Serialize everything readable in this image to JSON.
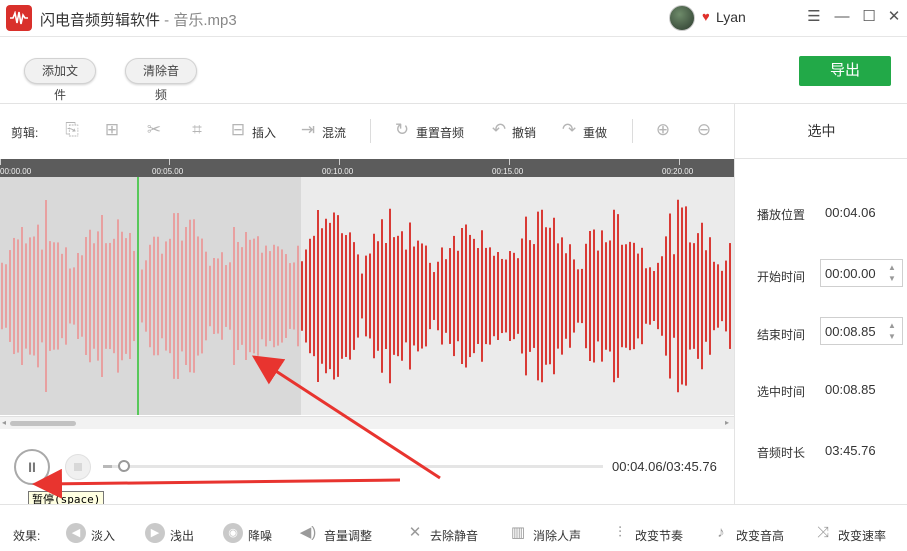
{
  "app": {
    "title": "闪电音频剪辑软件",
    "title_sep": " - ",
    "file_name": "音乐.mp3",
    "logo_icon": "waveform-logo-icon",
    "username": "Lyan",
    "window_buttons": [
      "☰",
      "—",
      "☐",
      "✕"
    ]
  },
  "toolbar": {
    "add_file": "添加文件",
    "clear_audio": "清除音频",
    "export": "导出"
  },
  "edit_toolbar": {
    "label": "剪辑:",
    "insert": "插入",
    "mix": "混流",
    "reset_audio": "重置音频",
    "undo": "撤销",
    "redo": "重做"
  },
  "right_panel": {
    "header": "选中",
    "play_position_label": "播放位置",
    "play_position_value": "00:04.06",
    "start_time_label": "开始时间",
    "start_time_value": "00:00.00",
    "end_time_label": "结束时间",
    "end_time_value": "00:08.85",
    "selected_time_label": "选中时间",
    "selected_time_value": "00:08.85",
    "duration_label": "音频时长",
    "duration_value": "03:45.76"
  },
  "timeline": {
    "ticks": [
      "00:00.00",
      "00:05.00",
      "00:10.00",
      "00:15.00",
      "00:20.00"
    ],
    "selection_color": "#e8a0a0",
    "wave_color": "#d93a35",
    "playhead_color": "#58c85a"
  },
  "playback": {
    "time_readout": "00:04.06/03:45.76",
    "progress_fraction": 0.018,
    "tooltip": "暂停(space)"
  },
  "effects": {
    "label": "效果:",
    "items": [
      "淡入",
      "浅出",
      "降噪",
      "音量调整",
      "去除静音",
      "消除人声",
      "改变节奏",
      "改变音高",
      "改变速率"
    ]
  },
  "colors": {
    "accent_green": "#22a948",
    "brand_red": "#d9302b",
    "annotation_red": "#e8342f"
  }
}
